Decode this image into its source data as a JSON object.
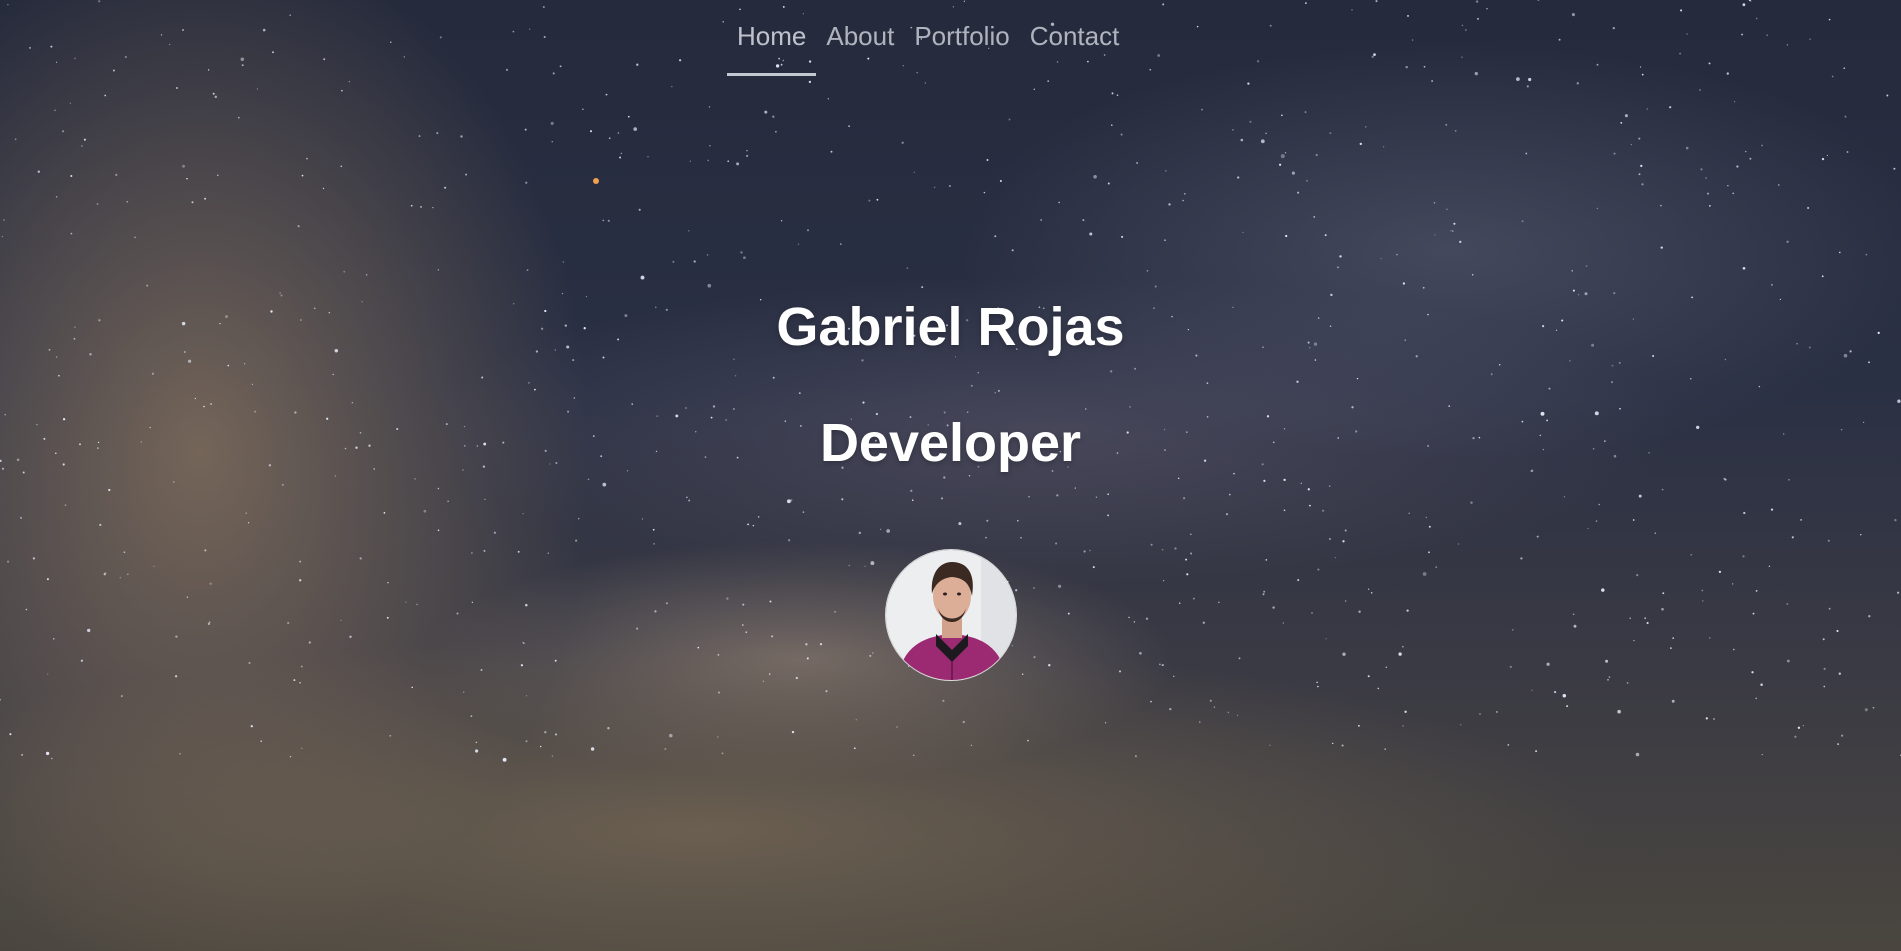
{
  "nav": {
    "items": [
      {
        "label": "Home",
        "active": true
      },
      {
        "label": "About",
        "active": false
      },
      {
        "label": "Portfolio",
        "active": false
      },
      {
        "label": "Contact",
        "active": false
      }
    ]
  },
  "hero": {
    "name": "Gabriel Rojas",
    "role": "Developer",
    "avatar_icon": "profile-photo"
  },
  "colors": {
    "text": "#ffffff",
    "nav_text": "#d8dae2",
    "background": "#252a3c",
    "jacket": "#9b2a73"
  }
}
